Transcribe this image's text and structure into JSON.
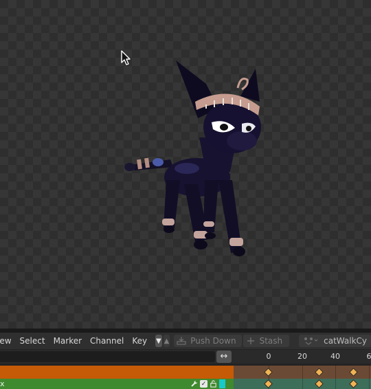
{
  "header": {
    "menu": [
      {
        "label": "iew",
        "name": "menu-view"
      },
      {
        "label": "Select",
        "name": "menu-select"
      },
      {
        "label": "Marker",
        "name": "menu-marker"
      },
      {
        "label": "Channel",
        "name": "menu-channel"
      },
      {
        "label": "Key",
        "name": "menu-key"
      }
    ],
    "push_down_label": "Push Down",
    "stash_label": "Stash",
    "action_name": "catWalkCy"
  },
  "timeline": {
    "frame_ticks": [
      "0",
      "20",
      "40",
      "6"
    ],
    "fit_icon": "↔"
  },
  "channels": {
    "action_label": "x"
  },
  "colors": {
    "summary_channel": "#c55a07",
    "action_channel": "#3f8a2e",
    "keyframe": "#f1b253",
    "channel_color_swatch": "#18c9c9"
  },
  "icons": {
    "cursor": "mouse-pointer-icon",
    "wrench": "wrench-icon",
    "checkbox": "checkbox-checked-icon",
    "lock": "lock-icon"
  }
}
